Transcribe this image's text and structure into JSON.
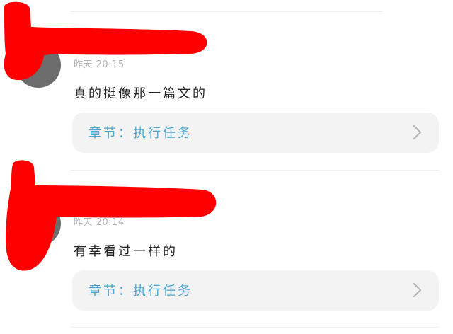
{
  "comments": [
    {
      "time": "昨天 20:15",
      "text": "真的挺像那一篇文的",
      "chapter_label": "章节：执行任务"
    },
    {
      "time": "昨天 20:14",
      "text": "有幸看过一样的",
      "chapter_label": "章节：执行任务"
    }
  ],
  "colors": {
    "chapter_link": "#4aa5cf",
    "card_background": "#f3f3f3",
    "redaction": "#ff0000"
  }
}
